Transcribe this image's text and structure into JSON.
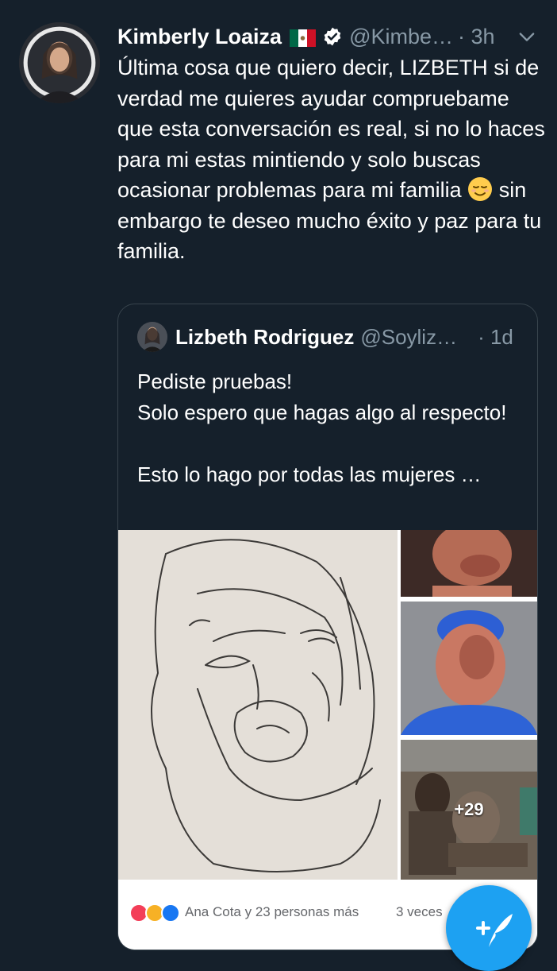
{
  "tweet": {
    "author_name": "Kimberly Loaiza",
    "author_handle": "@Kimbe…",
    "time": "· 3h",
    "text_before_emoji": "Última cosa que quiero decir, LIZBETH si de verdad me quieres ayudar compruebame que esta conversación es real, si no lo haces  para mi estas mintiendo y solo buscas ocasionar problemas para mi familia ",
    "text_after_emoji": " sin embargo te deseo mucho éxito y paz para tu familia."
  },
  "quoted": {
    "author_name": "Lizbeth Rodriguez",
    "author_handle": "@Soyliz…",
    "time": "· 1d",
    "text": "Pediste pruebas!\nSolo espero que hagas algo al respecto!\n\nEsto lo hago por todas las mujeres …",
    "media": {
      "more_count": "+29",
      "reaction_text": "Ana Cota y 23 personas más",
      "share_text": "3 veces"
    }
  },
  "colors": {
    "background": "#15202b",
    "secondary_text": "#8899a6",
    "border": "#38444d",
    "accent": "#1da1f2"
  },
  "icons": [
    "mexico-flag-icon",
    "verified-badge-icon",
    "chevron-down-icon",
    "relieved-face-emoji",
    "compose-tweet-icon"
  ]
}
